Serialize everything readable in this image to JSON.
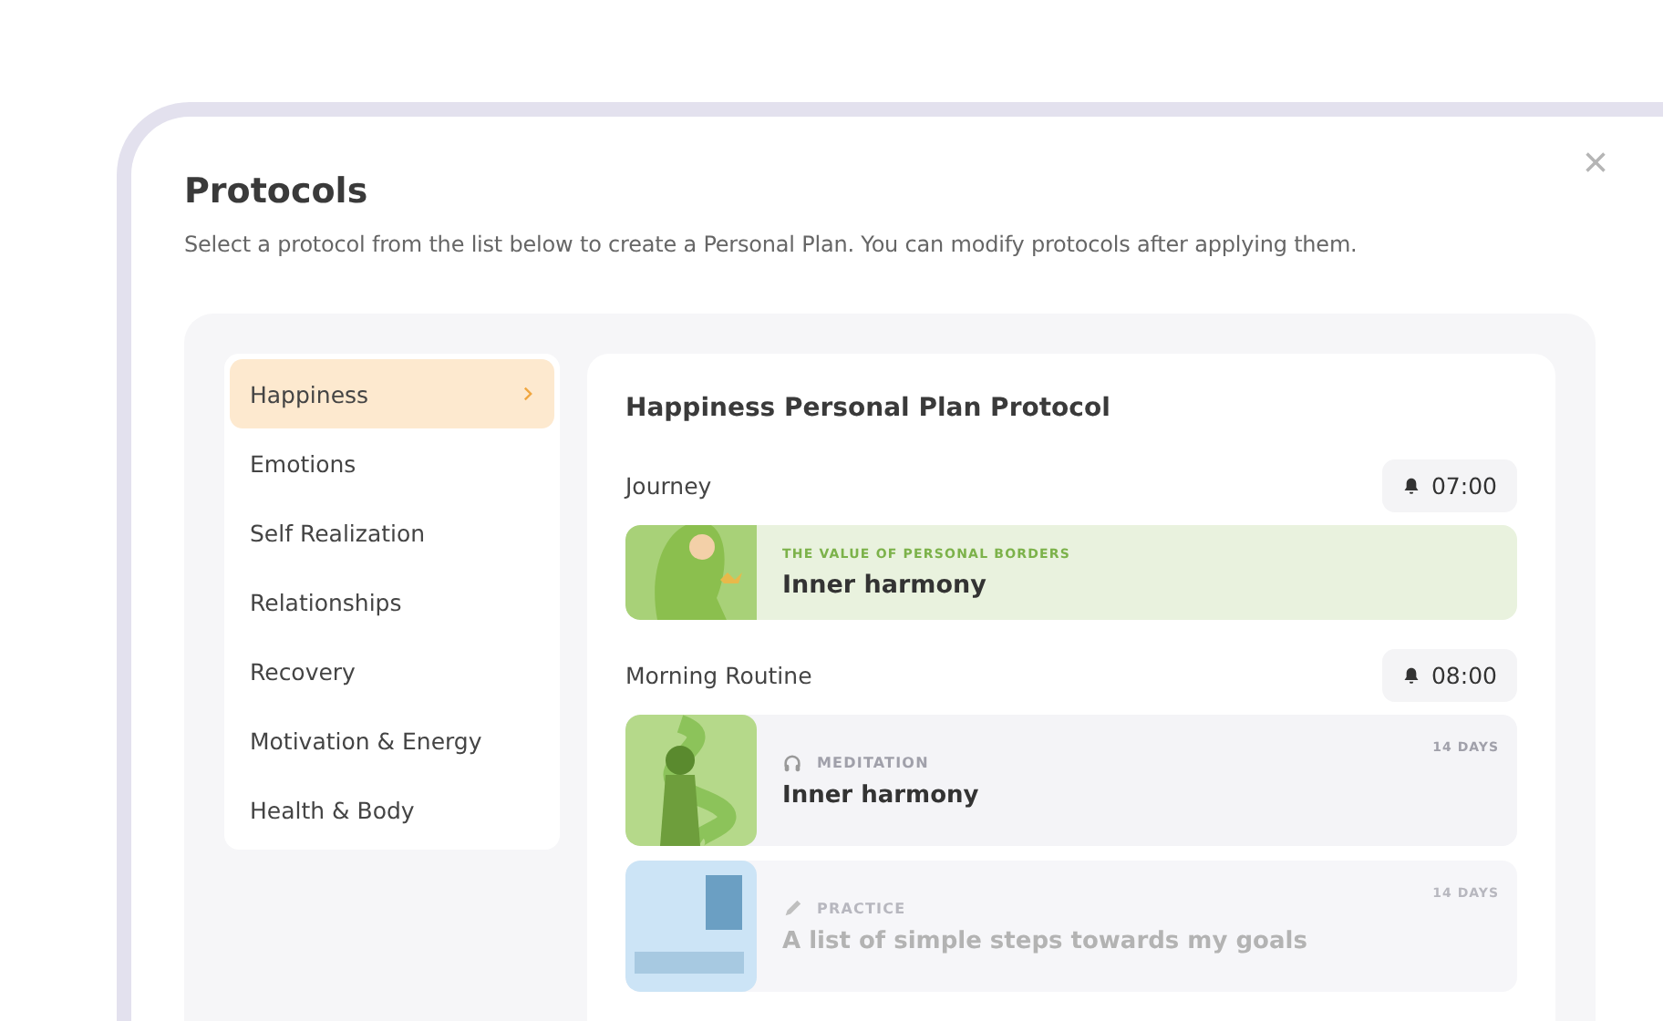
{
  "dialog": {
    "title": "Protocols",
    "description": "Select a protocol from the list below to create a Personal Plan. You can modify protocols after applying them.",
    "close": "×"
  },
  "sidebar": {
    "items": [
      {
        "label": "Happiness",
        "selected": true
      },
      {
        "label": "Emotions",
        "selected": false
      },
      {
        "label": "Self Realization",
        "selected": false
      },
      {
        "label": "Relationships",
        "selected": false
      },
      {
        "label": "Recovery",
        "selected": false
      },
      {
        "label": "Motivation & Energy",
        "selected": false
      },
      {
        "label": "Health & Body",
        "selected": false
      }
    ]
  },
  "protocol": {
    "title": "Happiness Personal Plan Protocol",
    "sections": [
      {
        "title": "Journey",
        "time": "07:00",
        "items": [
          {
            "kind": "journey",
            "category": "THE VALUE OF PERSONAL BORDERS",
            "title": "Inner harmony"
          }
        ]
      },
      {
        "title": "Morning Routine",
        "time": "08:00",
        "items": [
          {
            "kind": "meditation",
            "category": "MEDITATION",
            "title": "Inner harmony",
            "duration": "14 DAYS"
          },
          {
            "kind": "practice",
            "category": "PRACTICE",
            "title": "A list of simple steps towards my goals",
            "duration": "14 DAYS"
          }
        ]
      }
    ]
  }
}
